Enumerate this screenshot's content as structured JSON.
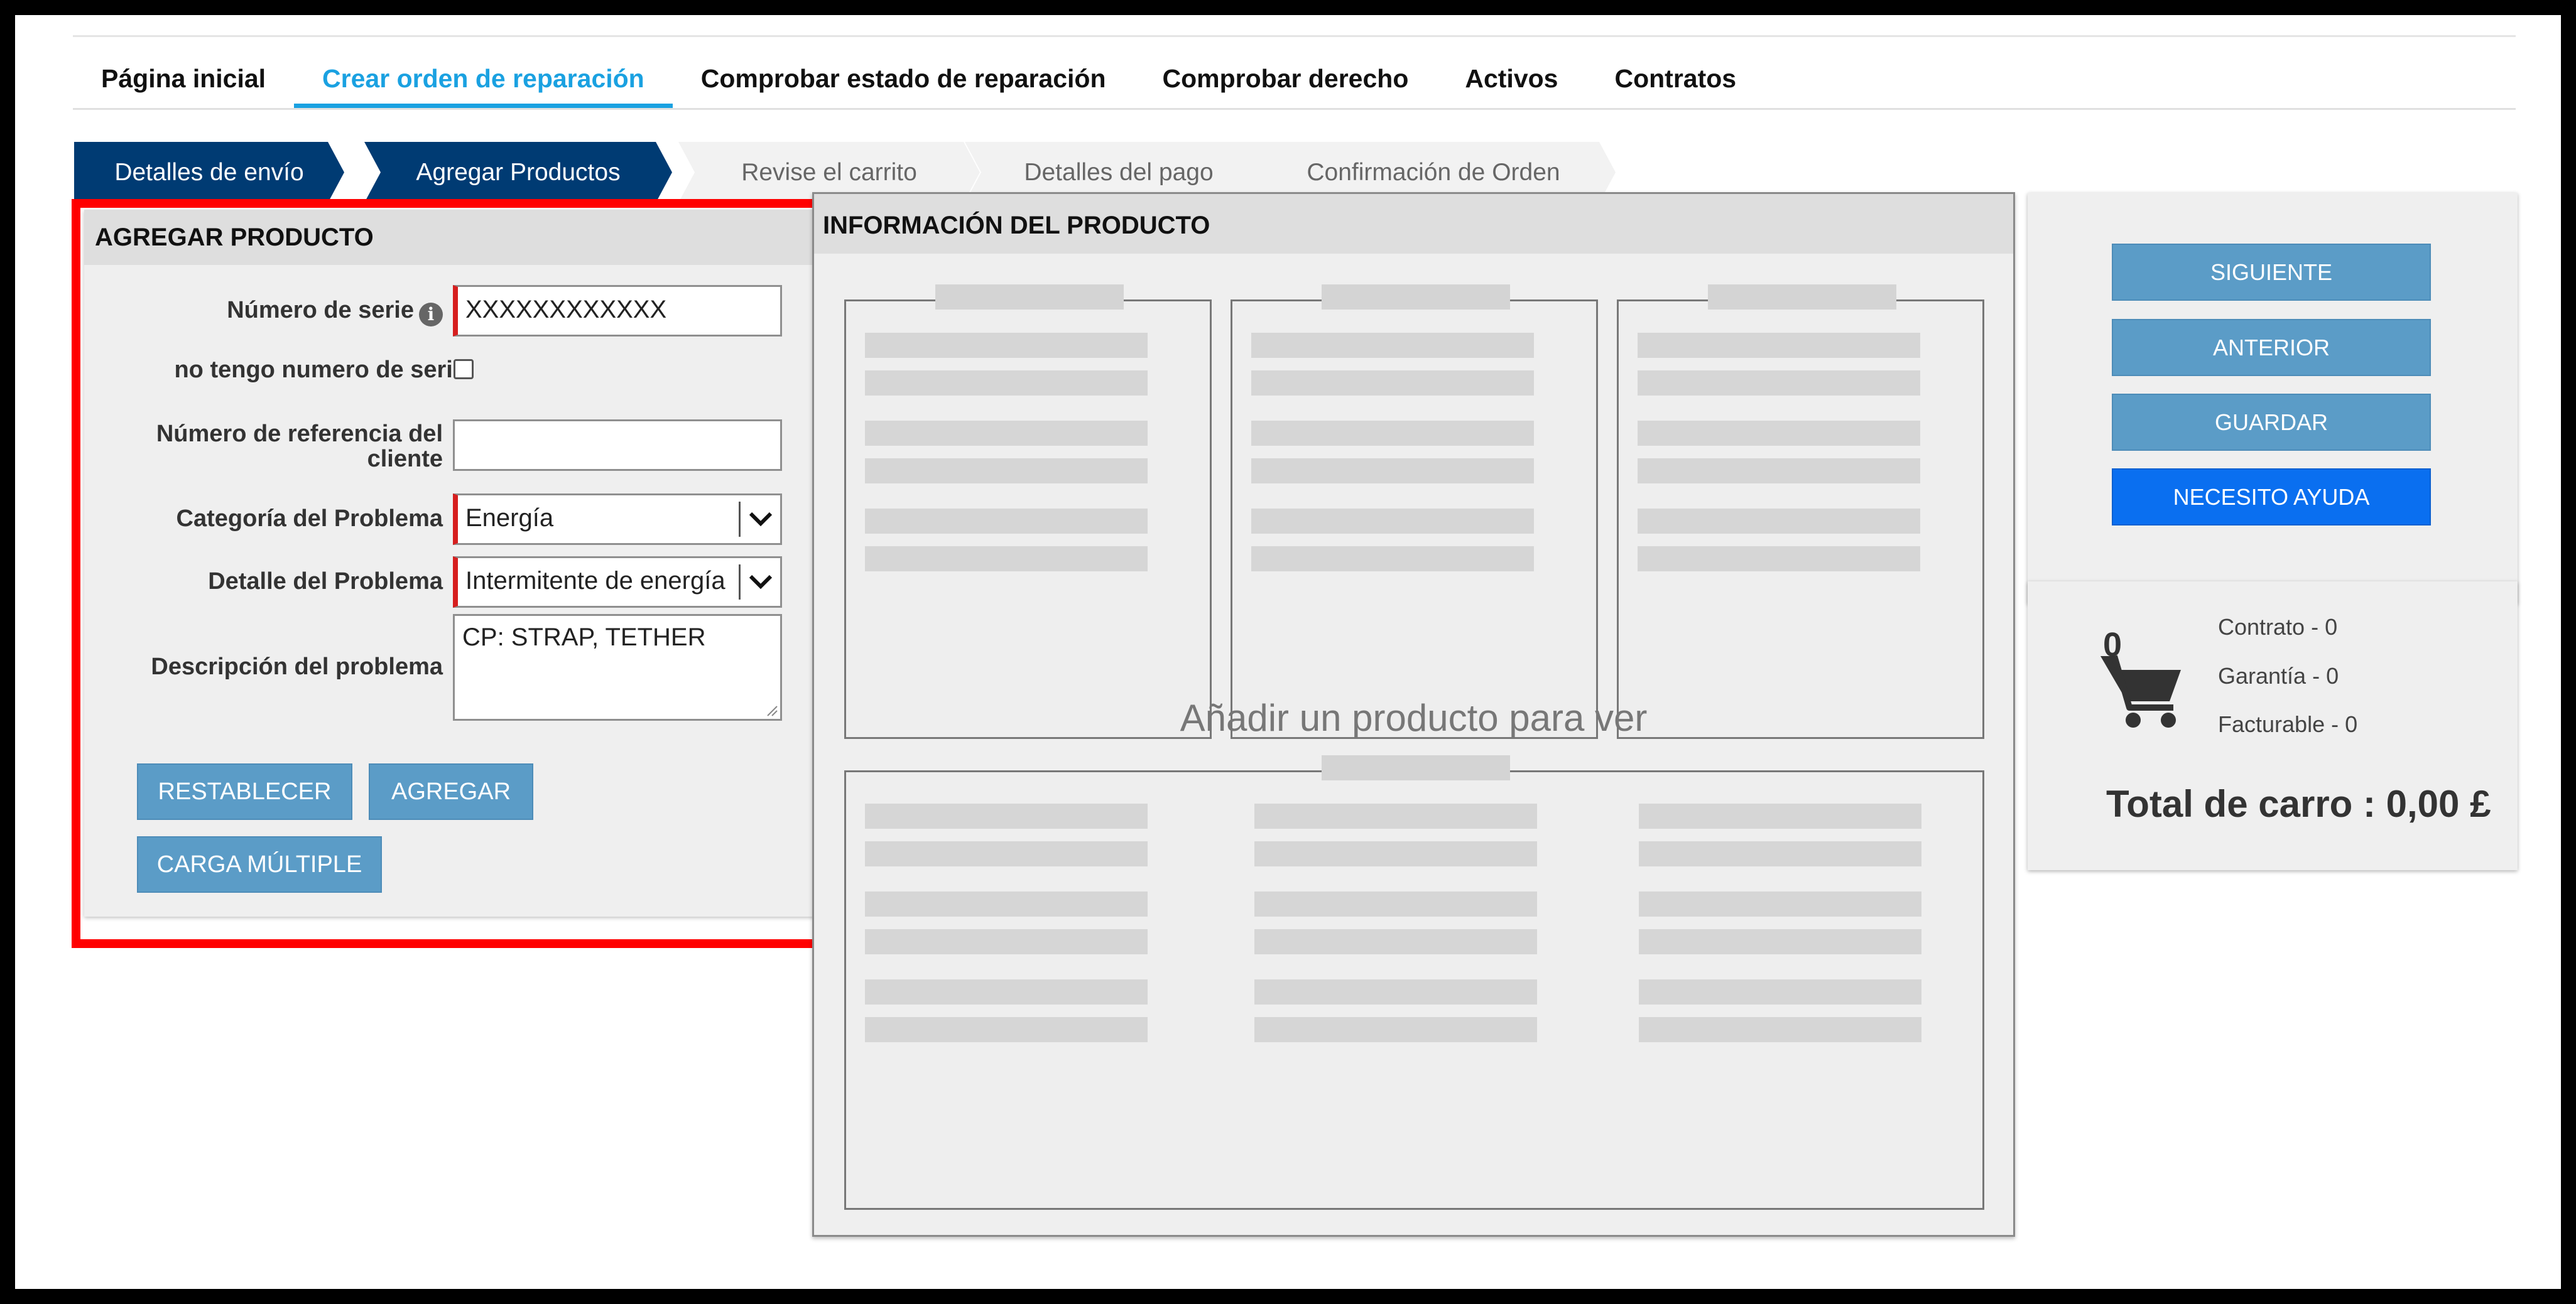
{
  "nav": {
    "items": [
      "Página inicial",
      "Crear orden de reparación",
      "Comprobar estado de reparación",
      "Comprobar derecho",
      "Activos",
      "Contratos"
    ],
    "active_index": 1
  },
  "steps": [
    {
      "label": "Detalles de envío",
      "status": "done"
    },
    {
      "label": "Agregar Productos",
      "status": "done"
    },
    {
      "label": "Revise el carrito",
      "status": "todo"
    },
    {
      "label": "Detalles del pago",
      "status": "todo"
    },
    {
      "label": "Confirmación de Orden",
      "status": "todo"
    }
  ],
  "add_product": {
    "title": "AGREGAR PRODUCTO",
    "serial_label": "Número de serie",
    "serial_value": "XXXXXXXXXXXX",
    "no_serial_label": "no tengo numero de serie",
    "no_serial_checked": false,
    "customer_ref_label_line1": "Número de referencia del",
    "customer_ref_label_line2": "cliente",
    "customer_ref_value": "",
    "problem_category_label": "Categoría del Problema",
    "problem_category_value": "Energía",
    "problem_detail_label": "Detalle del Problema",
    "problem_detail_value": "Intermitente de energía",
    "problem_description_label": "Descripción del problema",
    "problem_description_value": "CP: STRAP, TETHER",
    "reset_button": "RESTABLECER",
    "add_button": "AGREGAR",
    "bulk_upload_button": "CARGA MÚLTIPLE"
  },
  "product_info": {
    "title": "INFORMACIÓN DEL PRODUCTO",
    "placeholder": "Añadir un producto para ver"
  },
  "actions": {
    "next": "SIGUIENTE",
    "previous": "ANTERIOR",
    "save": "GUARDAR",
    "help": "NECESITO AYUDA"
  },
  "cart": {
    "count": "0",
    "contract": "Contrato - 0",
    "warranty": "Garantía - 0",
    "billable": "Facturable - 0",
    "total": "Total de carro : 0,00 £"
  },
  "colors": {
    "accent": "#1aa1e1",
    "step_done": "#003b73",
    "button": "#5b9cc7",
    "help_button": "#0a6ff0",
    "required_marker": "#d61f1f",
    "highlight": "#ff0000"
  }
}
